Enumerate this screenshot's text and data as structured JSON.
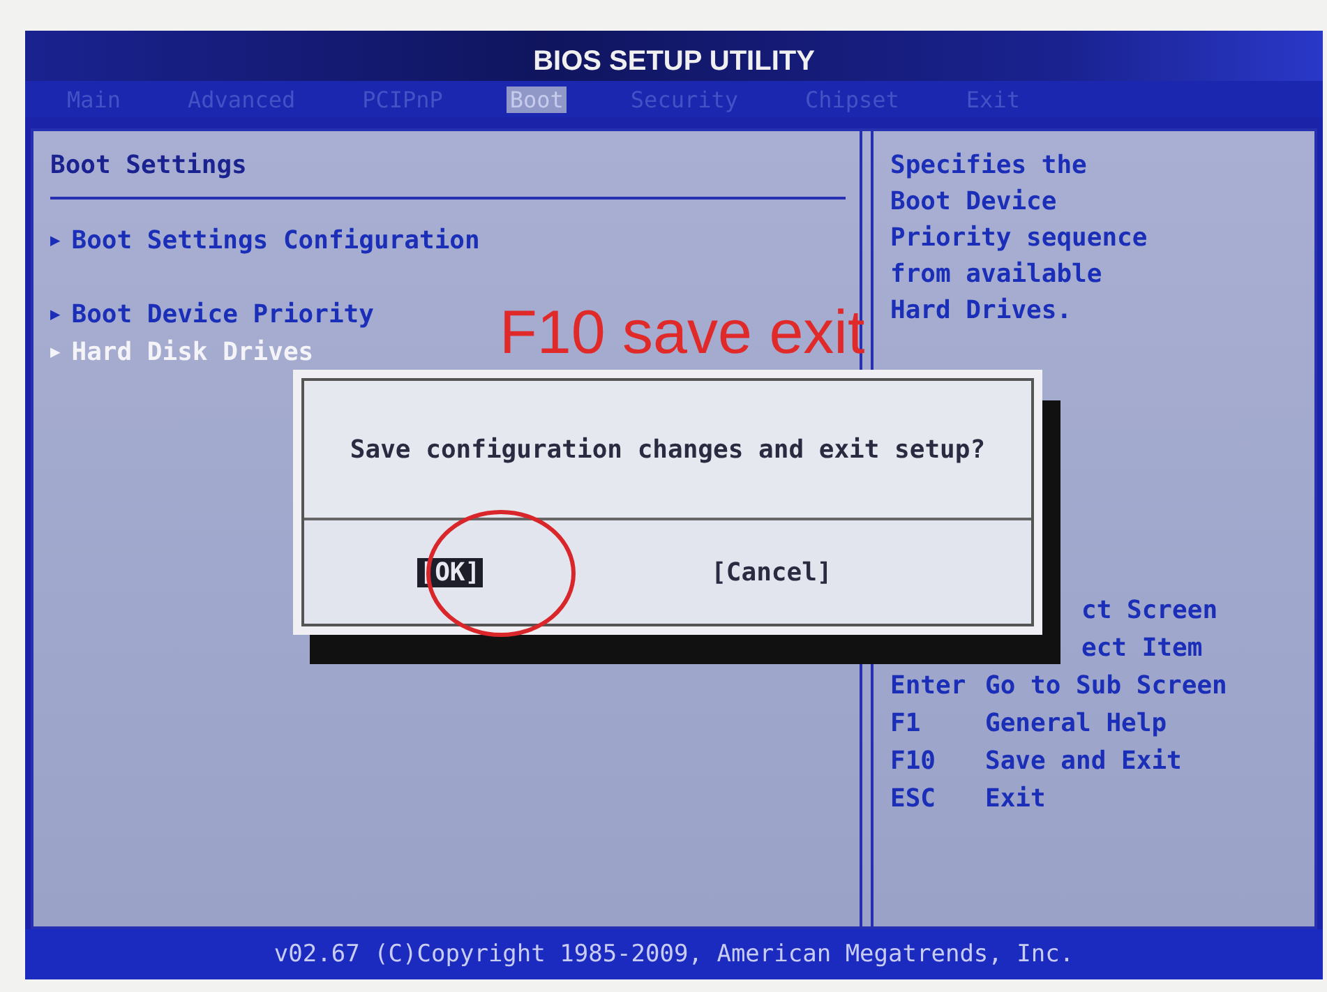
{
  "window": {
    "title": "BIOS SETUP UTILITY"
  },
  "tabs": [
    {
      "label": "Main",
      "selected": false
    },
    {
      "label": "Advanced",
      "selected": false
    },
    {
      "label": "PCIPnP",
      "selected": false
    },
    {
      "label": "Boot",
      "selected": true
    },
    {
      "label": "Security",
      "selected": false
    },
    {
      "label": "Chipset",
      "selected": false
    },
    {
      "label": "Exit",
      "selected": false
    }
  ],
  "section": {
    "title": "Boot Settings"
  },
  "menu_groups": [
    [
      {
        "marker": "▶",
        "label": "Boot Settings Configuration",
        "selected": false
      }
    ],
    [
      {
        "marker": "▶",
        "label": "Boot Device Priority",
        "selected": false
      },
      {
        "marker": "▶",
        "label": "Hard Disk Drives",
        "selected": true
      }
    ]
  ],
  "help": {
    "description": [
      "Specifies the",
      "Boot Device",
      "Priority sequence",
      "from available",
      "Hard Drives."
    ],
    "keys": [
      {
        "action": "ct Screen",
        "partial": true
      },
      {
        "action": "ect Item",
        "partial": true
      },
      {
        "key": "Enter",
        "action": "Go to Sub Screen"
      },
      {
        "key": "F1",
        "action": "General Help"
      },
      {
        "key": "F10",
        "action": "Save and Exit"
      },
      {
        "key": "ESC",
        "action": "Exit"
      }
    ]
  },
  "dialog": {
    "message": "Save configuration changes and exit setup?",
    "buttons": [
      {
        "label": "[OK]",
        "selected": true
      },
      {
        "label": "[Cancel]",
        "selected": false
      }
    ]
  },
  "annotation": {
    "text": "F10 save exit"
  },
  "footer": "v02.67 (C)Copyright 1985-2009, American Megatrends, Inc."
}
